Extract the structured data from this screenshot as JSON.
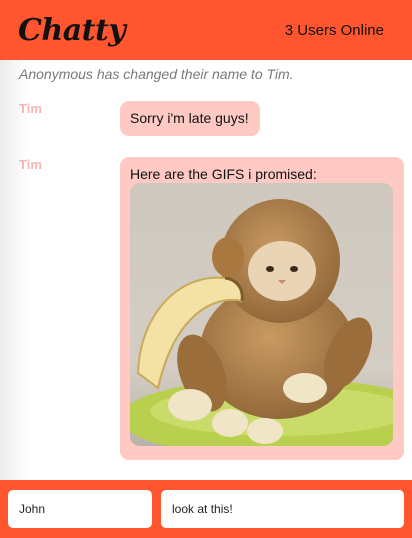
{
  "header": {
    "brand": "Chatty",
    "users_online": "3 Users Online"
  },
  "system_message": "Anonymous has changed their name to Tim.",
  "messages": [
    {
      "username": "Tim",
      "text": "Sorry i'm late guys!"
    },
    {
      "username": "Tim",
      "text": "Here are the GIFS i promised:",
      "image": "monkey-costume-cat-gif"
    }
  ],
  "footer": {
    "name_input_value": "John",
    "message_input_value": "look at this!"
  },
  "colors": {
    "brand_accent": "#ff5630",
    "bubble": "#ffc9c4",
    "username": "#f8b4b0"
  }
}
